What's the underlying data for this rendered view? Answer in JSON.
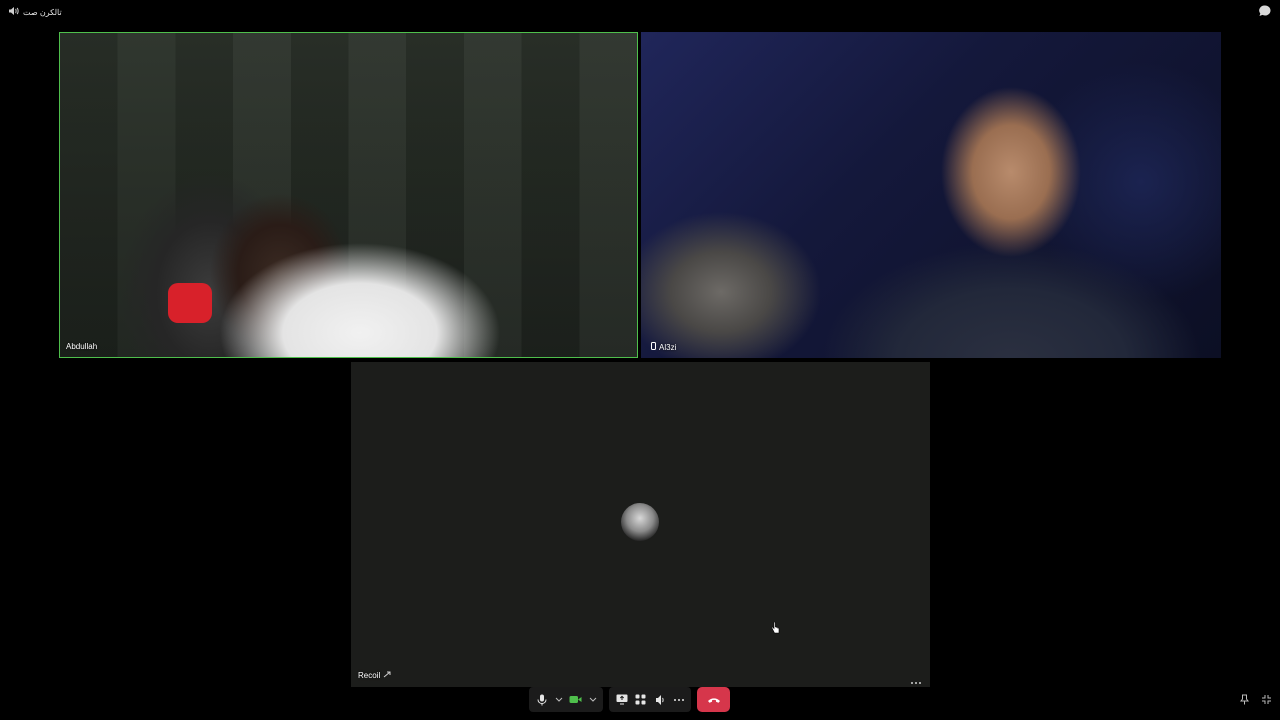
{
  "channel": {
    "name": "تالكرن صت"
  },
  "tiles": [
    {
      "name": "Abdullah",
      "speaking": true
    },
    {
      "name": "Al3zi"
    },
    {
      "name": "Recoil"
    }
  ],
  "colors": {
    "speaking_border": "#4fbf4c",
    "end_call": "#d6364b",
    "camera_on": "#4fbf4c"
  }
}
